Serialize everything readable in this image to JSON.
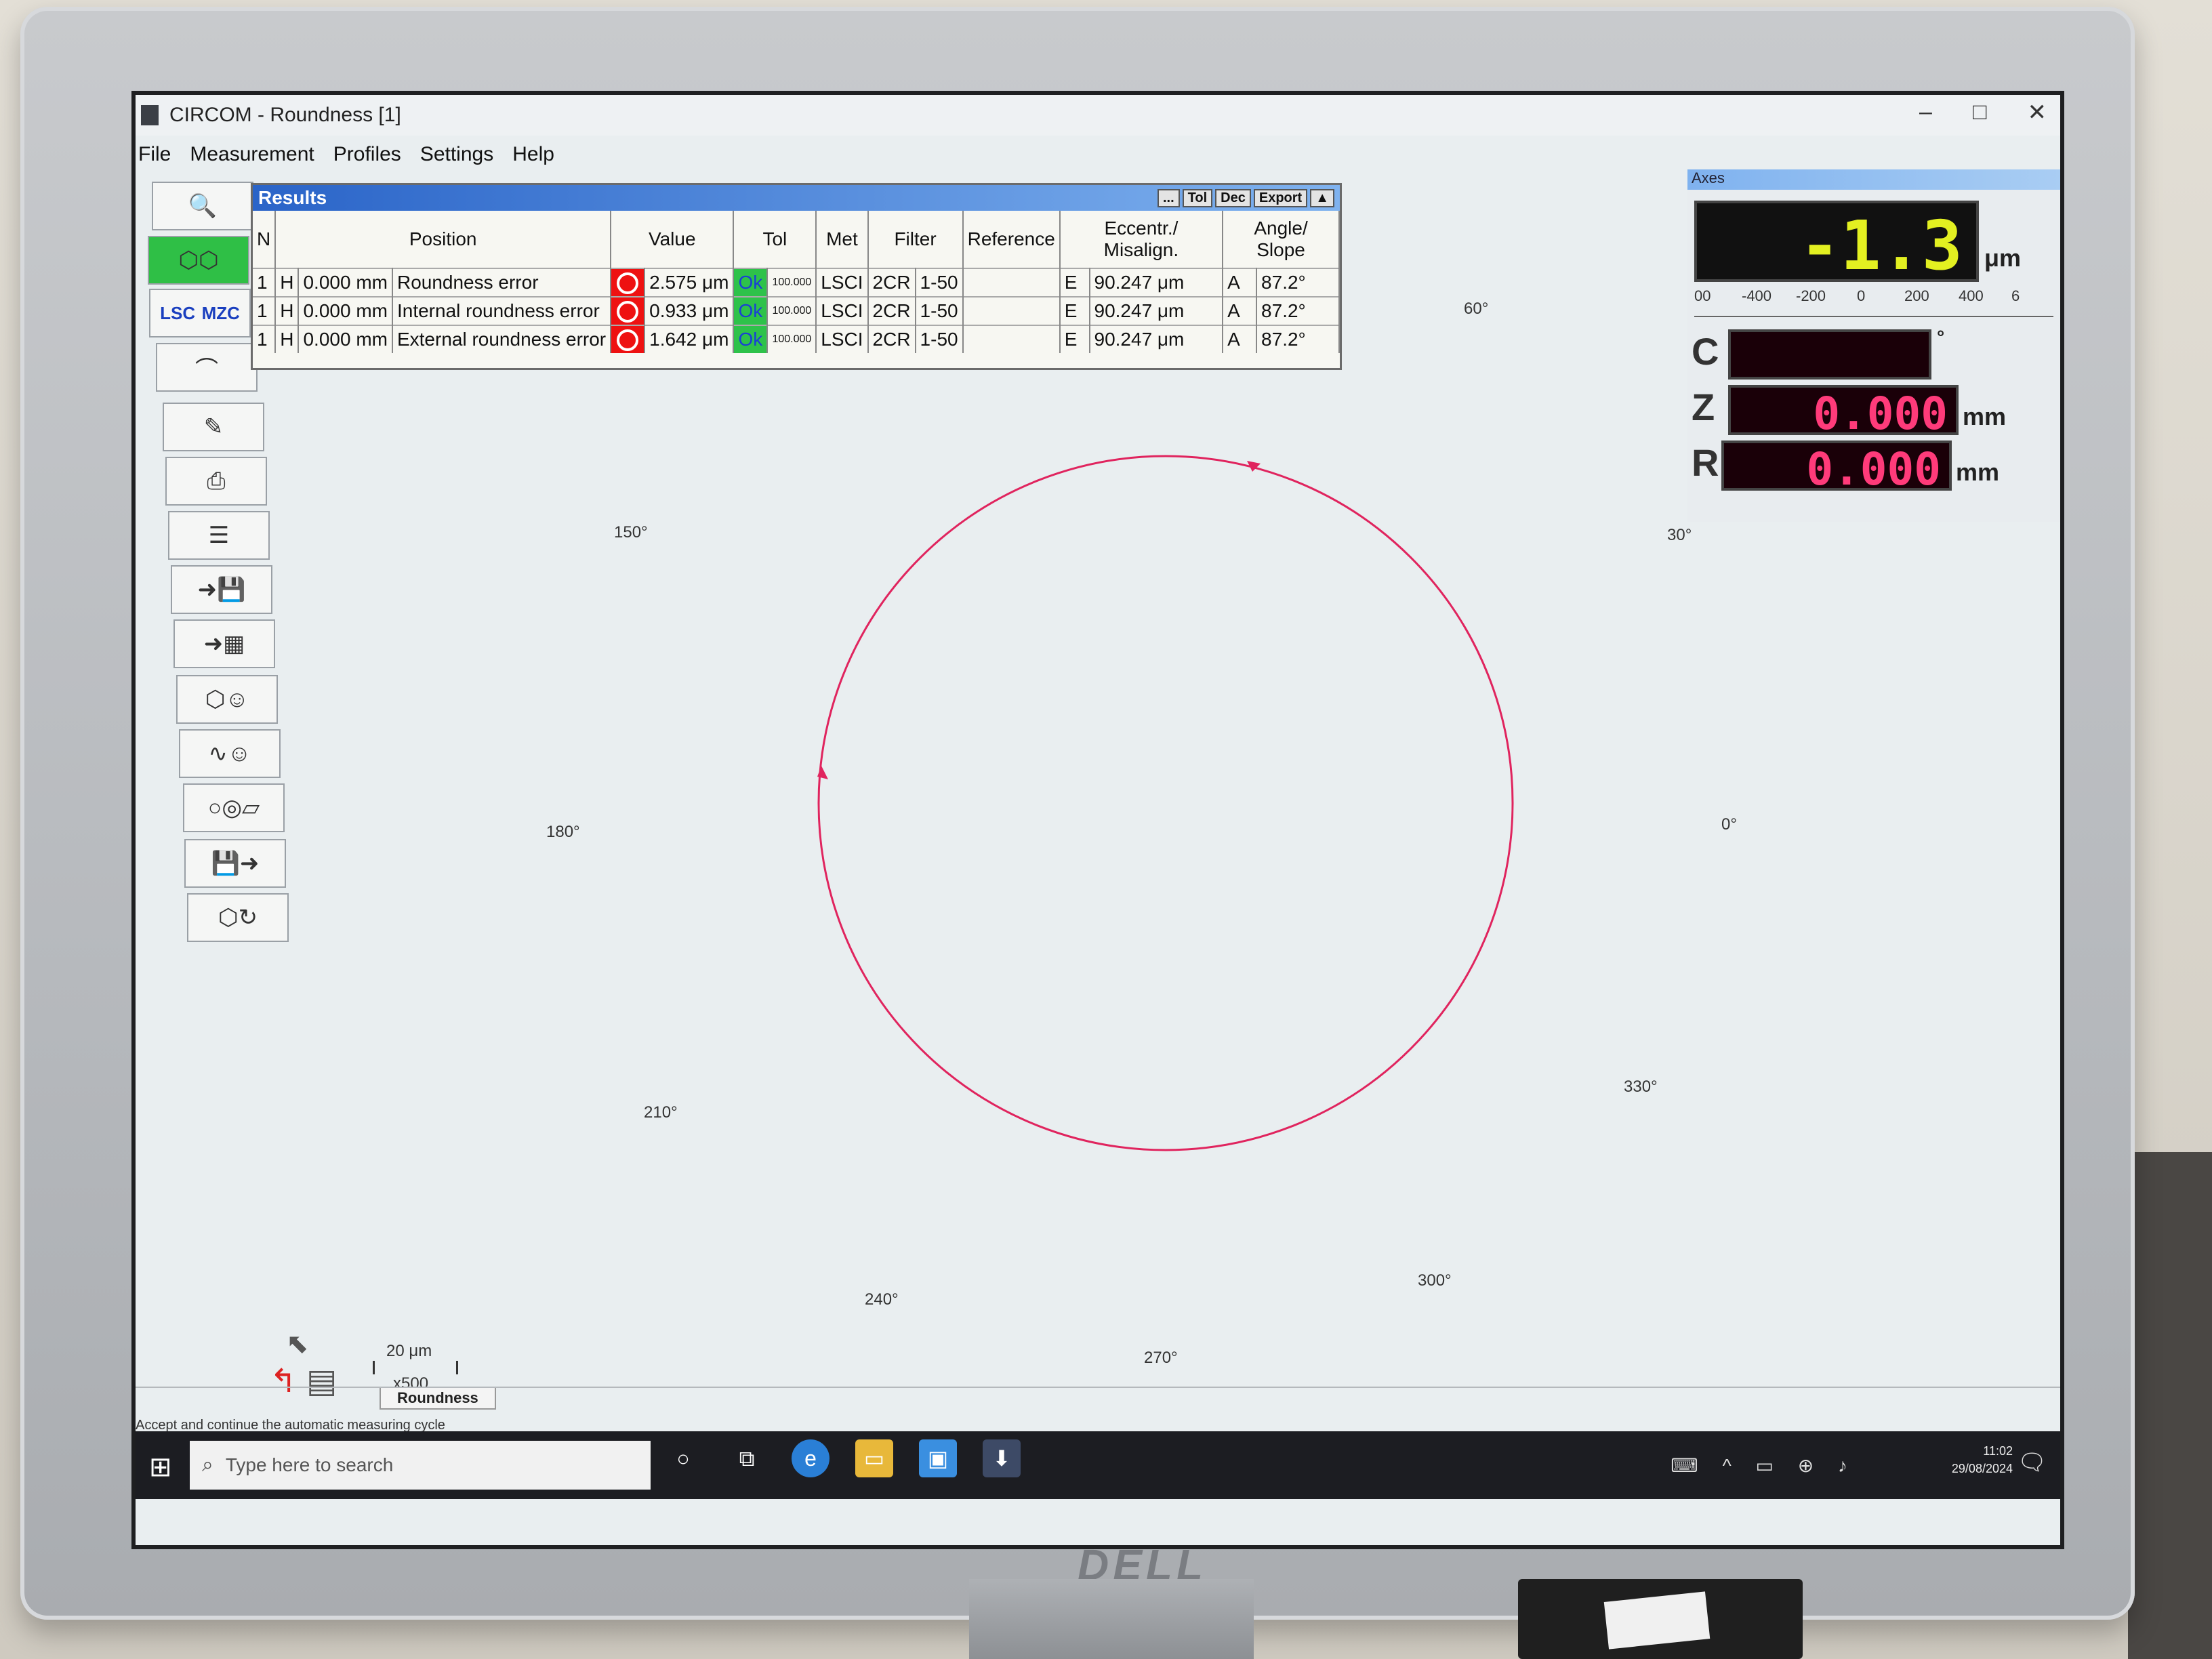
{
  "window": {
    "title": "CIRCOM - Roundness [1]"
  },
  "menu": [
    "File",
    "Measurement",
    "Profiles",
    "Settings",
    "Help"
  ],
  "toolbar": {
    "lsc": "LSC",
    "mzc": "MZC"
  },
  "results": {
    "title": "Results",
    "buttons": [
      "...",
      "Tol",
      "Dec",
      "Export"
    ],
    "headers": [
      "N",
      "Position",
      "Value",
      "Tol",
      "Met",
      "Filter",
      "Reference",
      "Eccentr./ Misalign.",
      "Angle/ Slope"
    ],
    "rows": [
      {
        "n": "1",
        "h": "H",
        "pos": "0.000 mm",
        "name": "Roundness error",
        "value": "2.575 μm",
        "ok": "Ok",
        "tol": "100.000",
        "met": "LSCI",
        "filter1": "2CR",
        "filter2": "1-50",
        "e": "E",
        "ecc": "90.247 μm",
        "a": "A",
        "angle": "87.2°"
      },
      {
        "n": "1",
        "h": "H",
        "pos": "0.000 mm",
        "name": "Internal roundness error",
        "value": "0.933 μm",
        "ok": "Ok",
        "tol": "100.000",
        "met": "LSCI",
        "filter1": "2CR",
        "filter2": "1-50",
        "e": "E",
        "ecc": "90.247 μm",
        "a": "A",
        "angle": "87.2°"
      },
      {
        "n": "1",
        "h": "H",
        "pos": "0.000 mm",
        "name": "External roundness error",
        "value": "1.642 μm",
        "ok": "Ok",
        "tol": "100.000",
        "met": "LSCI",
        "filter1": "2CR",
        "filter2": "1-50",
        "e": "E",
        "ecc": "90.247 μm",
        "a": "A",
        "angle": "87.2°"
      }
    ]
  },
  "polar": {
    "angles": {
      "a0": "0°",
      "a30": "30°",
      "a60": "60°",
      "a150": "150°",
      "a180": "180°",
      "a210": "210°",
      "a240": "240°",
      "a270": "270°",
      "a300": "300°",
      "a330": "330°"
    },
    "trace_color": "#e0245e"
  },
  "axes": {
    "title": "Axes",
    "main_value": "-1.3",
    "main_unit": "μm",
    "scale_ticks": [
      "00",
      "-400",
      "-200",
      "0",
      "200",
      "400",
      "6"
    ],
    "c_label": "C",
    "c_unit": "°",
    "z_label": "Z",
    "z_value": "0.000",
    "z_unit": "mm",
    "r_label": "R",
    "r_value": "0.000",
    "r_unit": "mm"
  },
  "scale": {
    "value": "20 μm",
    "magnification": "x500"
  },
  "tab": "Roundness",
  "status": "Accept and continue the automatic measuring cycle",
  "taskbar": {
    "search_placeholder": "Type here to search",
    "time": "11:02",
    "date": "29/08/2024"
  },
  "brand": "DELL"
}
